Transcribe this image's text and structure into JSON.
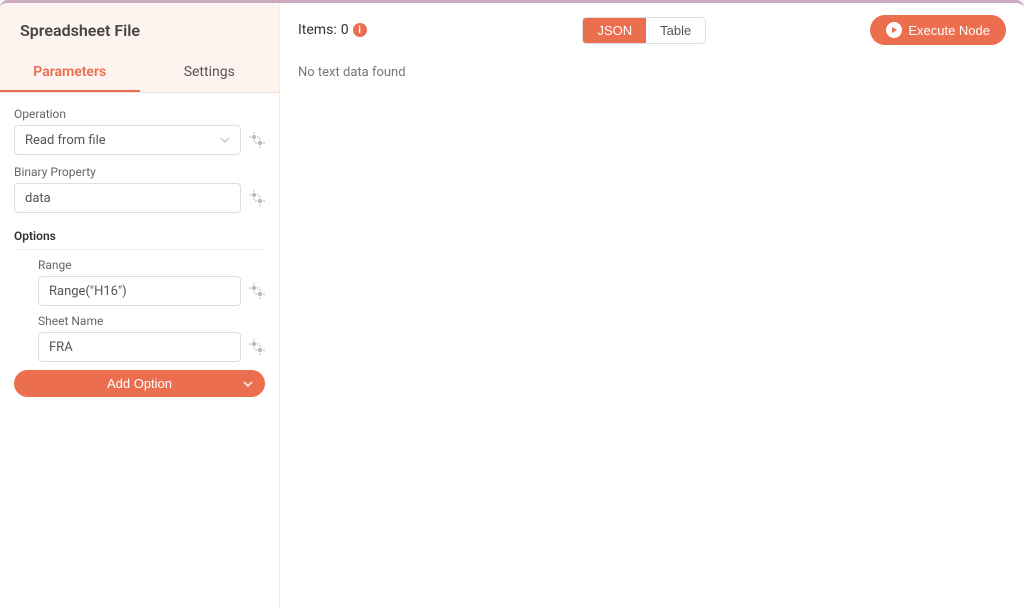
{
  "node": {
    "title": "Spreadsheet File"
  },
  "tabs": {
    "parameters": "Parameters",
    "settings": "Settings"
  },
  "fields": {
    "operation": {
      "label": "Operation",
      "value": "Read from file"
    },
    "binaryProperty": {
      "label": "Binary Property",
      "value": "data"
    }
  },
  "options": {
    "header": "Options",
    "range": {
      "label": "Range",
      "value": "Range(\"H16\")"
    },
    "sheetName": {
      "label": "Sheet Name",
      "value": "FRA"
    },
    "addButton": "Add Option"
  },
  "output": {
    "itemsLabel": "Items:",
    "itemsCount": "0",
    "jsonBtn": "JSON",
    "tableBtn": "Table",
    "executeBtn": "Execute Node",
    "emptyMessage": "No text data found"
  }
}
